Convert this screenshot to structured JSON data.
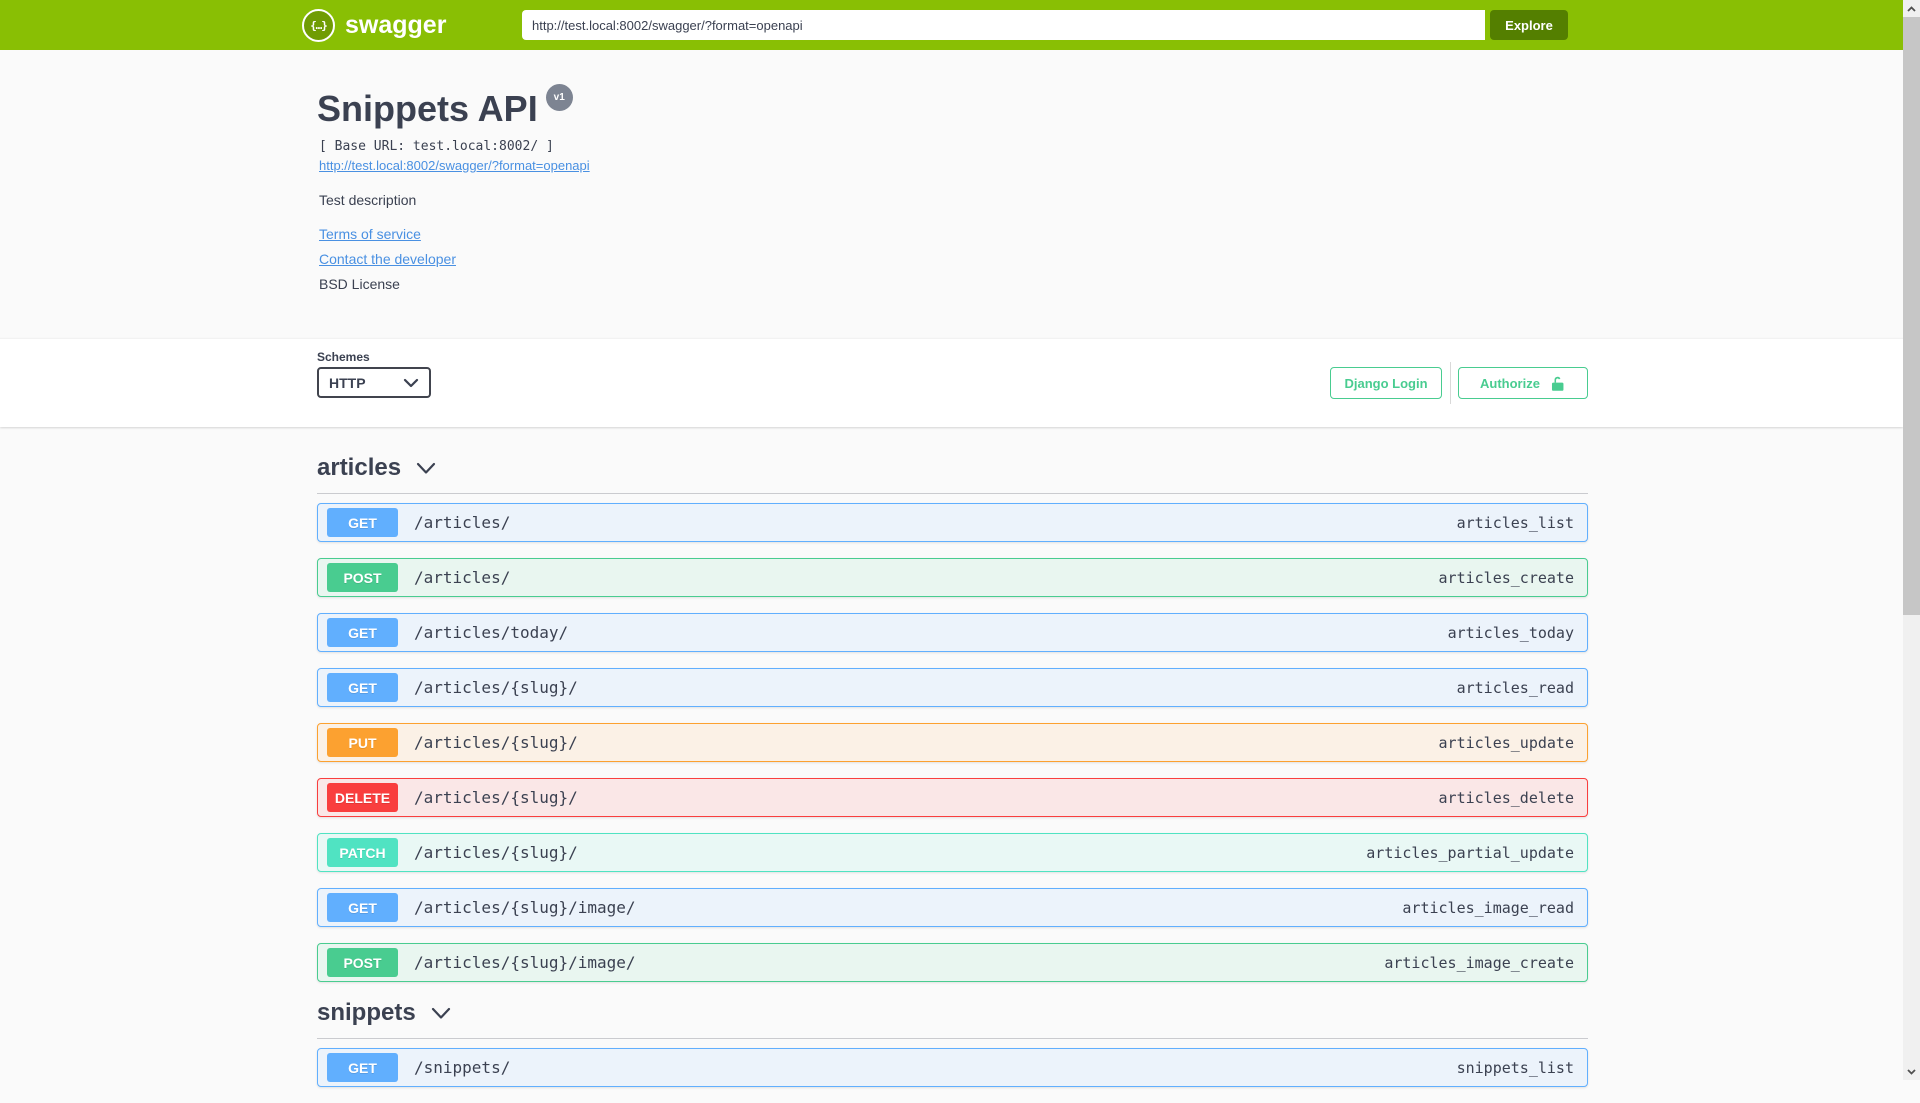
{
  "topbar": {
    "logo_glyph": "{…}",
    "logo_text": "swagger",
    "url_value": "http://test.local:8002/swagger/?format=openapi",
    "explore_label": "Explore"
  },
  "info": {
    "title": "Snippets API",
    "version_badge": "v1",
    "base_url_text": "[ Base URL: test.local:8002/ ]",
    "spec_link": "http://test.local:8002/swagger/?format=openapi",
    "description": "Test description",
    "terms_link": "Terms of service",
    "contact_link": "Contact the developer",
    "license_text": "BSD License"
  },
  "scheme": {
    "label": "Schemes",
    "selected": "HTTP"
  },
  "auth": {
    "django_login_label": "Django Login",
    "authorize_label": "Authorize"
  },
  "colors": {
    "topbar": "#89bf04",
    "explore_button": "#547f00",
    "link": "#4990e2",
    "text": "#3b4151",
    "accent_green": "#49cc90",
    "version_badge_bg": "#7d8492",
    "methods": {
      "GET": {
        "color": "#61affe",
        "tint": "#ecf3fb"
      },
      "POST": {
        "color": "#49cc90",
        "tint": "#e9f6f0"
      },
      "PUT": {
        "color": "#fca130",
        "tint": "#fbf1e6"
      },
      "DELETE": {
        "color": "#f93e3e",
        "tint": "#fae7e7"
      },
      "PATCH": {
        "color": "#50e3c2",
        "tint": "#e9f8f5"
      }
    }
  },
  "sections": [
    {
      "name": "articles",
      "operations": [
        {
          "method": "GET",
          "path": "/articles/",
          "op_id": "articles_list"
        },
        {
          "method": "POST",
          "path": "/articles/",
          "op_id": "articles_create"
        },
        {
          "method": "GET",
          "path": "/articles/today/",
          "op_id": "articles_today"
        },
        {
          "method": "GET",
          "path": "/articles/{slug}/",
          "op_id": "articles_read"
        },
        {
          "method": "PUT",
          "path": "/articles/{slug}/",
          "op_id": "articles_update"
        },
        {
          "method": "DELETE",
          "path": "/articles/{slug}/",
          "op_id": "articles_delete"
        },
        {
          "method": "PATCH",
          "path": "/articles/{slug}/",
          "op_id": "articles_partial_update"
        },
        {
          "method": "GET",
          "path": "/articles/{slug}/image/",
          "op_id": "articles_image_read"
        },
        {
          "method": "POST",
          "path": "/articles/{slug}/image/",
          "op_id": "articles_image_create"
        }
      ]
    },
    {
      "name": "snippets",
      "operations": [
        {
          "method": "GET",
          "path": "/snippets/",
          "op_id": "snippets_list"
        }
      ]
    }
  ]
}
